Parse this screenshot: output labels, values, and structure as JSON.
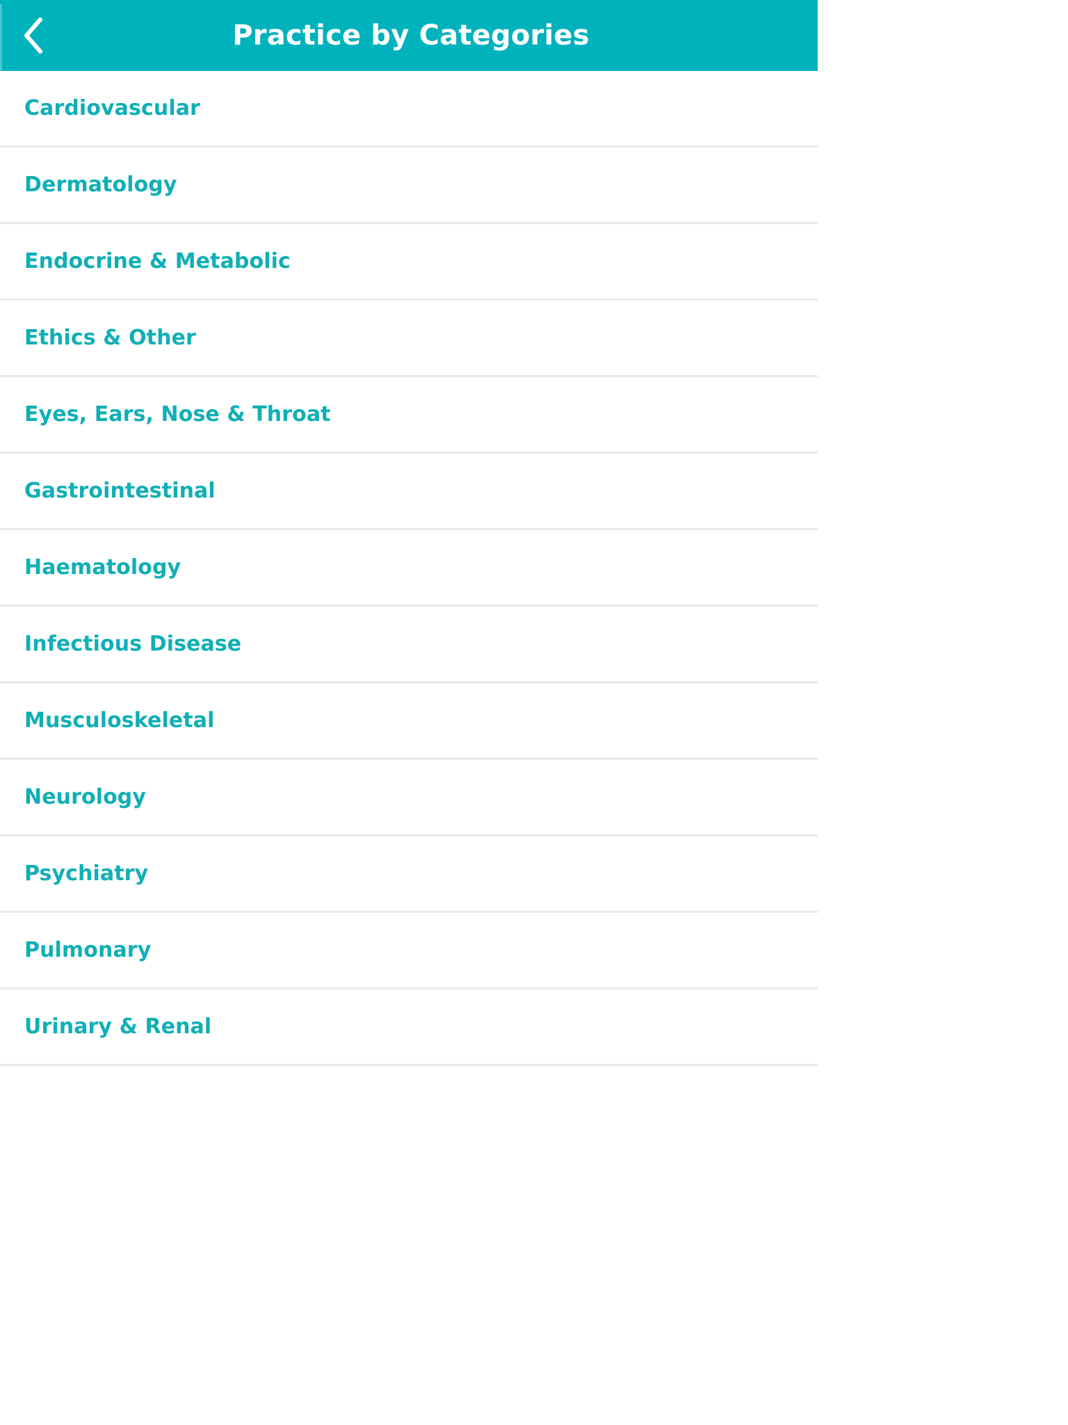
{
  "app": {
    "title": "Practice by Categories",
    "accent_color": "#00b2bb",
    "list_text_color": "#10afb6",
    "separator_color": "#e9e9e9",
    "background_color": "#ffffff"
  },
  "header": {
    "title": "Practice by Categories",
    "back_icon": "chevron-left-icon"
  },
  "list": {
    "items": [
      {
        "label": "Cardiovascular"
      },
      {
        "label": "Dermatology"
      },
      {
        "label": "Endocrine & Metabolic"
      },
      {
        "label": "Ethics & Other"
      },
      {
        "label": "Eyes, Ears, Nose & Throat"
      },
      {
        "label": "Gastrointestinal"
      },
      {
        "label": "Haematology"
      },
      {
        "label": "Infectious Disease"
      },
      {
        "label": "Musculoskeletal"
      },
      {
        "label": "Neurology"
      },
      {
        "label": "Psychiatry"
      },
      {
        "label": "Pulmonary"
      },
      {
        "label": "Urinary & Renal"
      }
    ]
  }
}
